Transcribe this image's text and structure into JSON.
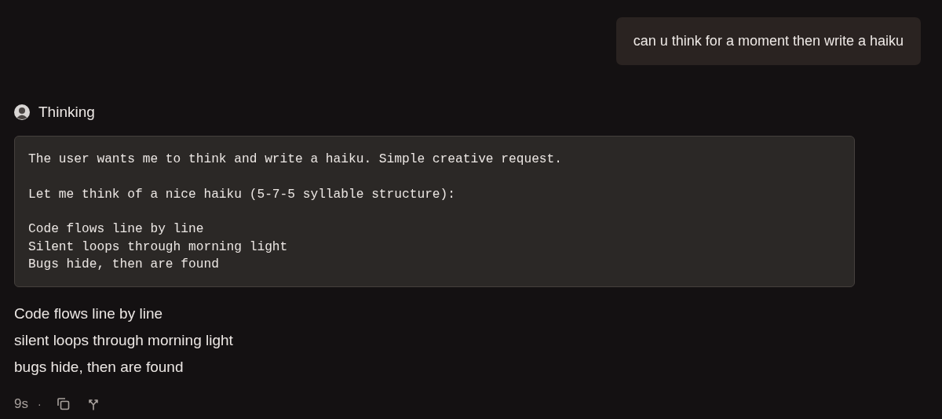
{
  "user_message": {
    "text": "can u think for a moment then write a haiku"
  },
  "thinking": {
    "label": "Thinking",
    "paragraphs": [
      [
        "The user wants me to think and write a haiku. Simple creative request."
      ],
      [
        "Let me think of a nice haiku (5-7-5 syllable structure):"
      ],
      [
        "Code flows line by line",
        "Silent loops through morning light",
        "Bugs hide, then are found"
      ]
    ]
  },
  "response": {
    "lines": [
      "Code flows line by line",
      "silent loops through morning light",
      "bugs hide, then are found"
    ]
  },
  "footer": {
    "duration": "9s",
    "separator": "·"
  }
}
